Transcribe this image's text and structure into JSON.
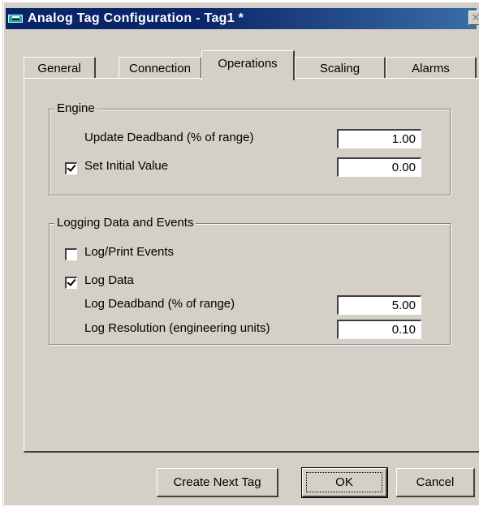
{
  "window": {
    "title": "Analog Tag Configuration - Tag1 *",
    "close_glyph": "✕"
  },
  "tabs": [
    {
      "label": "General"
    },
    {
      "label": "Connection"
    },
    {
      "label": "Operations"
    },
    {
      "label": "Scaling"
    },
    {
      "label": "Alarms"
    }
  ],
  "active_tab": "Operations",
  "engine": {
    "legend": "Engine",
    "update_deadband_label": "Update Deadband (% of range)",
    "update_deadband_value": "1.00",
    "set_initial_label": "Set Initial Value",
    "set_initial_checked": true,
    "initial_value": "0.00"
  },
  "logging": {
    "legend": "Logging Data and Events",
    "log_print_label": "Log/Print Events",
    "log_print_checked": false,
    "log_data_label": "Log Data",
    "log_data_checked": true,
    "log_deadband_label": "Log Deadband (% of range)",
    "log_deadband_value": "5.00",
    "log_resolution_label": "Log Resolution (engineering units)",
    "log_resolution_value": "0.10"
  },
  "buttons": {
    "create_next": "Create Next Tag",
    "ok": "OK",
    "cancel": "Cancel"
  },
  "icons": {
    "app": "analog-tag-icon",
    "close": "close-icon"
  }
}
